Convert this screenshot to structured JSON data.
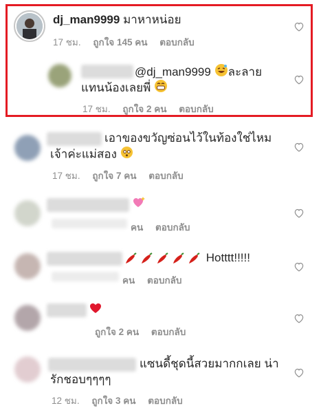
{
  "comments": [
    {
      "username": "dj_man9999",
      "text": "มาหาหน่อย",
      "time": "17 ชม.",
      "likes": "ถูกใจ 145 คน",
      "reply": "ตอบกลับ"
    },
    {
      "mention": "@dj_man9999",
      "text_line1": "ละลาย",
      "text_line2": "แทนน้องเลยพี่",
      "time": "17 ชม.",
      "likes": "ถูกใจ 2 คน",
      "reply": "ตอบกลับ"
    },
    {
      "text_line1": "เอาของขวัญซ่อนไว้ในท้องใช่ไหม",
      "text_line2": "เจ้าค่ะแม่สอง",
      "time": "17 ชม.",
      "likes": "ถูกใจ 7 คน",
      "reply": "ตอบกลับ"
    },
    {
      "time": "",
      "likes": "คน",
      "reply": "ตอบกลับ"
    },
    {
      "text": "Hotttt!!!!!",
      "likes": "คน",
      "reply": "ตอบกลับ"
    },
    {
      "likes": "ถูกใจ 2 คน",
      "reply": "ตอบกลับ"
    },
    {
      "text_line1": "แซนดี้ชุดนี้สวยมากกเลย น่า",
      "text_line2": "รักชอบๆๆๆๆ",
      "time": "12 ชม.",
      "likes": "ถูกใจ 3 คน",
      "reply": "ตอบกลับ"
    }
  ],
  "colors": {
    "highlight": "#e41b23",
    "meta": "#8e8e8e",
    "text": "#262626"
  }
}
